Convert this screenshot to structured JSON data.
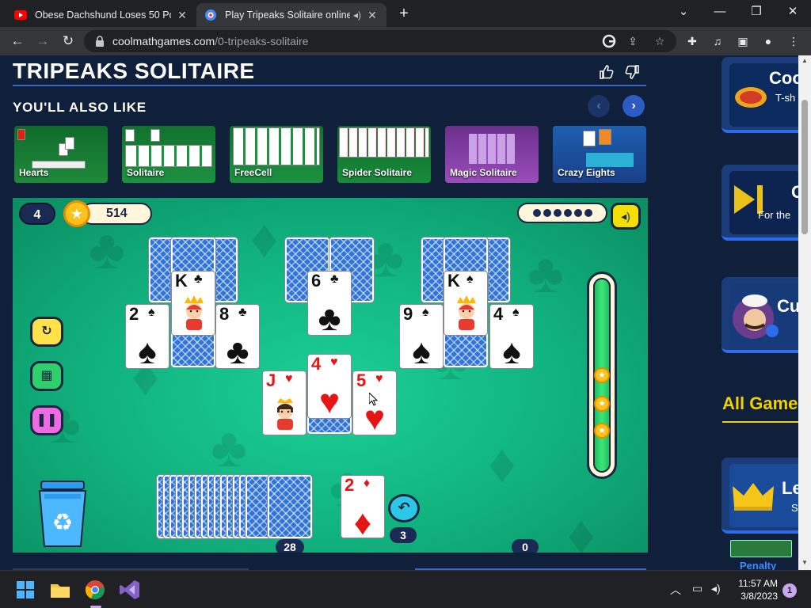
{
  "browser": {
    "tabs": [
      {
        "title": "Obese Dachshund Loses 50 Pour",
        "icon": "youtube-icon",
        "active": false
      },
      {
        "title": "Play Tripeaks Solitaire online",
        "icon": "coolmath-icon",
        "active": true
      }
    ],
    "url_host": "coolmathgames.com",
    "url_path": "/0-tripeaks-solitaire"
  },
  "page": {
    "title": "TRIPEAKS SOLITAIRE",
    "also_like": "YOU'LL ALSO LIKE",
    "recommendations": [
      "Hearts",
      "Solitaire",
      "FreeCell",
      "Spider Solitaire",
      "Magic Solitaire",
      "Crazy Eights"
    ]
  },
  "game": {
    "level": "4",
    "score": "514",
    "stock_count": "28",
    "undo_count": "3",
    "bonus_count": "0",
    "tableau": [
      {
        "rank": "K",
        "suit": "♣",
        "color": "black"
      },
      {
        "rank": "2",
        "suit": "♠",
        "color": "black"
      },
      {
        "rank": "8",
        "suit": "♣",
        "color": "black"
      },
      {
        "rank": "6",
        "suit": "♣",
        "color": "black"
      },
      {
        "rank": "K",
        "suit": "♠",
        "color": "black"
      },
      {
        "rank": "9",
        "suit": "♠",
        "color": "black"
      },
      {
        "rank": "4",
        "suit": "♠",
        "color": "black"
      },
      {
        "rank": "J",
        "suit": "♥",
        "color": "red"
      },
      {
        "rank": "4",
        "suit": "♥",
        "color": "red"
      },
      {
        "rank": "5",
        "suit": "♥",
        "color": "red"
      }
    ],
    "waste": {
      "rank": "2",
      "suit": "♦",
      "color": "red"
    },
    "colors": {
      "felt": "#10b07c",
      "accent_dark": "#1b2a55",
      "card_back": "#2f74d6"
    }
  },
  "sidebar": {
    "promos": [
      {
        "title": "Coo",
        "subtitle": "T-sh"
      },
      {
        "title": "C",
        "subtitle": "For the"
      },
      {
        "title": "Cu",
        "subtitle": ""
      },
      {
        "title": "Le",
        "subtitle": "S"
      }
    ],
    "all_games": "All Game",
    "penalty": "Penalty"
  },
  "taskbar": {
    "time": "11:57 AM",
    "date": "3/8/2023",
    "notifications": "1"
  }
}
